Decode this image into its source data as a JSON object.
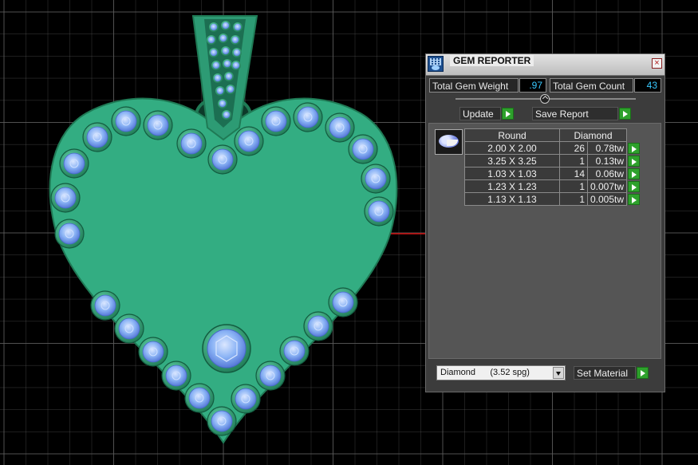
{
  "viewport": {
    "colors": {
      "background": "#000000",
      "grid": "#5a5a5a",
      "metal": "#33ad82",
      "metal_dark": "#1f7a55",
      "gem": "#8ab3f5",
      "axis": "#d01010"
    }
  },
  "gem_reporter": {
    "title": "GEM REPORTER",
    "close_label": "×",
    "total_gem_weight_label": "Total Gem Weight",
    "total_gem_weight_value": ".97",
    "total_gem_count_label": "Total Gem Count",
    "total_gem_count_value": "43",
    "update_label": "Update",
    "save_report_label": "Save Report",
    "table": {
      "shape_header": "Round",
      "material_header": "Diamond",
      "rows": [
        {
          "size": "2.00 X 2.00",
          "count": "26",
          "weight": "0.78tw"
        },
        {
          "size": "3.25 X 3.25",
          "count": "1",
          "weight": "0.13tw"
        },
        {
          "size": "1.03 X 1.03",
          "count": "14",
          "weight": "0.06tw"
        },
        {
          "size": "1.23 X 1.23",
          "count": "1",
          "weight": "0.007tw"
        },
        {
          "size": "1.13 X 1.13",
          "count": "1",
          "weight": "0.005tw"
        }
      ]
    },
    "material_select_value": "Diamond      (3.52 spg)",
    "set_material_label": "Set Material",
    "colors": {
      "value_text": "#38c8ff",
      "play_button": "#2ea12c"
    }
  }
}
